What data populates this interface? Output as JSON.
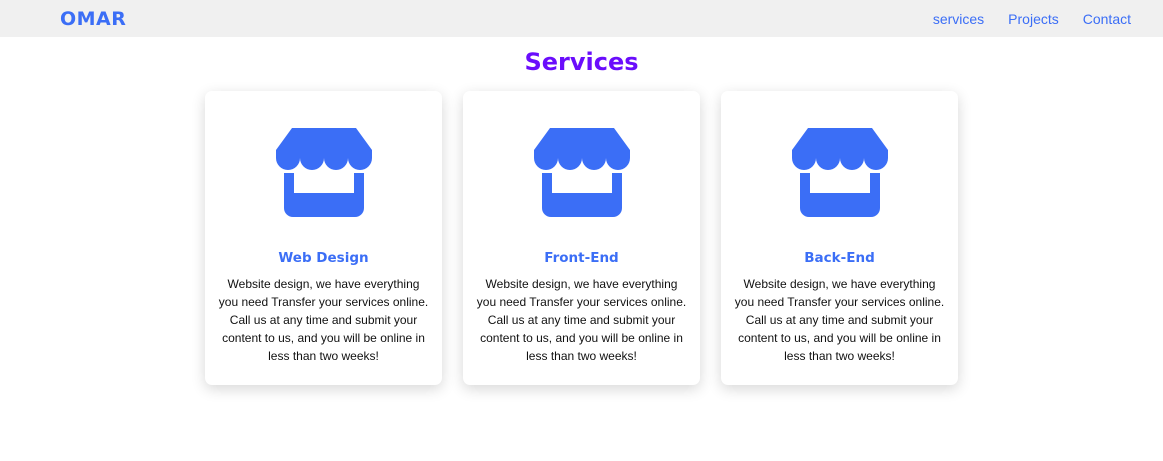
{
  "navbar": {
    "brand": "OMAR",
    "links": [
      "services",
      "Projects",
      "Contact"
    ]
  },
  "services": {
    "title": "Services",
    "cards": [
      {
        "icon": "storefront-icon",
        "title": "Web Design",
        "text": "Website design, we have everything you need Transfer your services online. Call us at any time and submit your content to us, and you will be online in less than two weeks!"
      },
      {
        "icon": "storefront-icon",
        "title": "Front-End",
        "text": "Website design, we have everything you need Transfer your services online. Call us at any time and submit your content to us, and you will be online in less than two weeks!"
      },
      {
        "icon": "storefront-icon",
        "title": "Back-End",
        "text": "Website design, we have everything you need Transfer your services online. Call us at any time and submit your content to us, and you will be online in less than two weeks!"
      }
    ]
  },
  "colors": {
    "accent": "#3b6ef6",
    "heading": "#6a0dfc",
    "navbar_bg": "#f0f0f0"
  }
}
